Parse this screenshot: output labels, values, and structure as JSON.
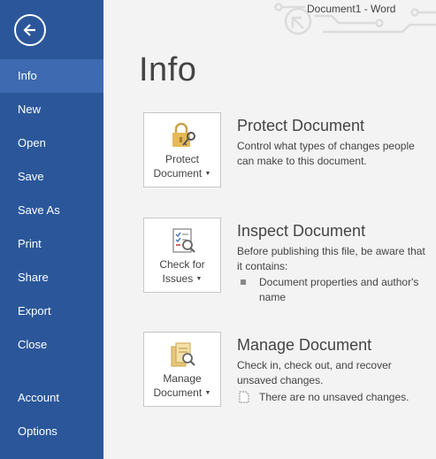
{
  "window": {
    "title": "Document1 - Word"
  },
  "sidebar": {
    "items": [
      {
        "label": "Info",
        "active": true
      },
      {
        "label": "New"
      },
      {
        "label": "Open"
      },
      {
        "label": "Save"
      },
      {
        "label": "Save As"
      },
      {
        "label": "Print"
      },
      {
        "label": "Share"
      },
      {
        "label": "Export"
      },
      {
        "label": "Close"
      },
      {
        "label": "Account"
      },
      {
        "label": "Options"
      }
    ]
  },
  "main": {
    "title": "Info",
    "protect": {
      "button_line1": "Protect",
      "button_line2": "Document",
      "heading": "Protect Document",
      "description": "Control what types of changes people can make to this document."
    },
    "inspect": {
      "button_line1": "Check for",
      "button_line2": "Issues",
      "heading": "Inspect Document",
      "description": "Before publishing this file, be aware that it contains:",
      "bullet": "Document properties and author's name"
    },
    "manage": {
      "button_line1": "Manage",
      "button_line2": "Document",
      "heading": "Manage Document",
      "description": "Check in, check out, and recover unsaved changes.",
      "note": "There are no unsaved changes."
    }
  },
  "colors": {
    "sidebar_bg": "#2b579a",
    "sidebar_active": "#3d6ab0",
    "content_bg": "#f3f3f3"
  },
  "icons": [
    "back-arrow-icon",
    "lock-key-icon",
    "checklist-magnifier-icon",
    "document-magnifier-icon",
    "square-bullet-icon",
    "document-page-icon"
  ]
}
